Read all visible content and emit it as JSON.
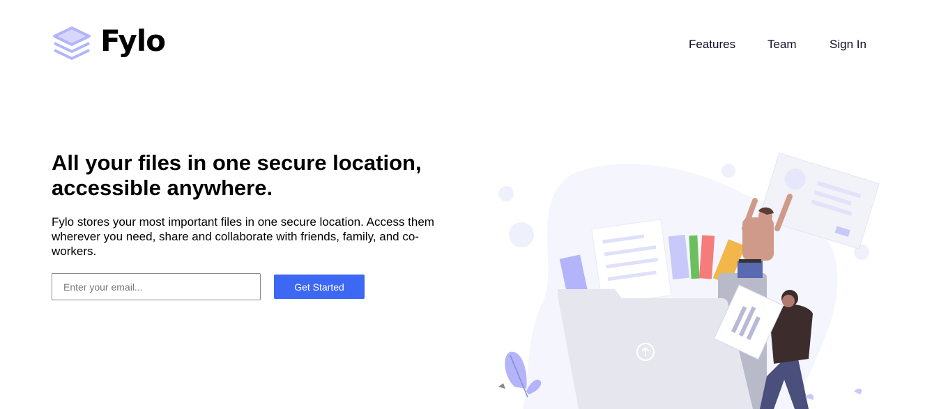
{
  "brand": {
    "name": "Fylo",
    "logo_icon": "stacked-layers-icon",
    "logo_color": "#b3b4f9"
  },
  "nav": {
    "features": "Features",
    "team": "Team",
    "signin": "Sign In"
  },
  "hero": {
    "title_line1": "All your files in one secure location,",
    "title_line2": "accessible anywhere.",
    "description": "Fylo stores your most important files in one secure location. Access them wherever you need, share and collaborate with friends, family, and co-workers."
  },
  "signup": {
    "email_placeholder": "Enter your email...",
    "email_value": "",
    "button_label": "Get Started"
  },
  "colors": {
    "accent": "#3c68f3",
    "nav_text": "#0c0e2a",
    "illustration_purple": "#b3b4f9"
  }
}
